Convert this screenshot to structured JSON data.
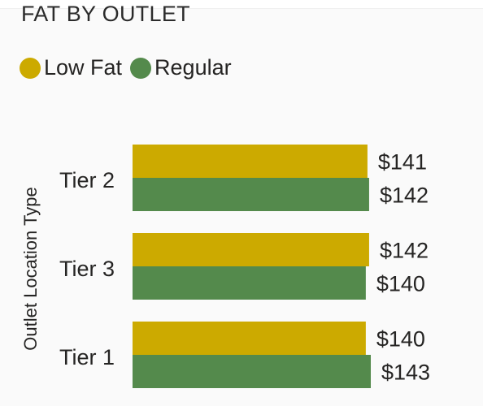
{
  "chart_data": {
    "type": "bar",
    "orientation": "horizontal",
    "title": "FAT BY OUTLET",
    "ylabel": "Outlet Location Type",
    "xlabel": "",
    "categories": [
      "Tier 2",
      "Tier 3",
      "Tier 1"
    ],
    "series": [
      {
        "name": "Low Fat",
        "color": "#ccaa00",
        "values": [
          141,
          142,
          140
        ],
        "labels": [
          "$141",
          "$142",
          "$140"
        ]
      },
      {
        "name": "Regular",
        "color": "#548a4c",
        "values": [
          142,
          140,
          143
        ],
        "labels": [
          "$142",
          "$140",
          "$143"
        ]
      }
    ],
    "xlim": [
      0,
      143
    ],
    "grid": false,
    "legend_position": "top-left"
  }
}
